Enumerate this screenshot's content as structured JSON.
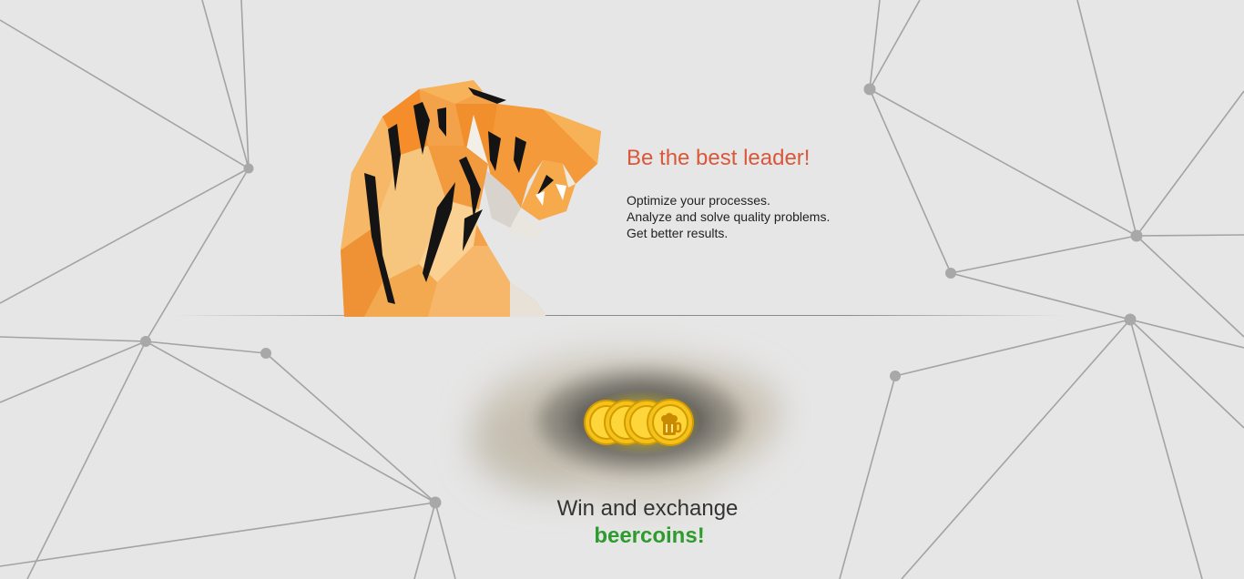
{
  "hero": {
    "title": "Be the best leader!",
    "lines": [
      "Optimize your processes.",
      "Analyze and solve quality problems.",
      "Get better results."
    ]
  },
  "reward": {
    "title": "Win and exchange",
    "accent": "beercoins!"
  },
  "colors": {
    "title_accent": "#d9583a",
    "beercoins_green": "#2e9b2e",
    "background": "#e6e6e6",
    "network_line": "#9a9a9a"
  },
  "icons": {
    "mascot": "low-poly-tiger-illustration",
    "coins": "beer-mug-coin-icon"
  }
}
